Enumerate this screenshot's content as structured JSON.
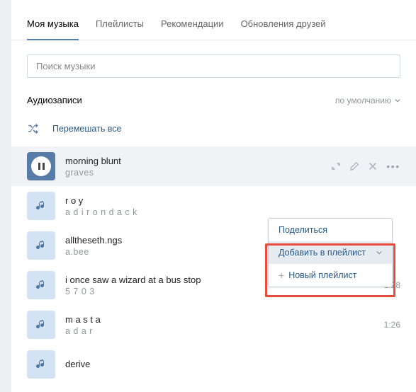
{
  "tabs": [
    "Моя музыка",
    "Плейлисты",
    "Рекомендации",
    "Обновления друзей"
  ],
  "search": {
    "placeholder": "Поиск музыки"
  },
  "section": {
    "title": "Аудиозаписи",
    "sort": "по умолчанию"
  },
  "shuffle": "Перемешать все",
  "tracks": [
    {
      "title": "morning blunt",
      "artist": "graves",
      "duration": ""
    },
    {
      "title": "r o y",
      "artist": "a d i r o n d a c k",
      "duration": ""
    },
    {
      "title": "alltheseth.ngs",
      "artist": "a.bee",
      "duration": ""
    },
    {
      "title": "i once saw a wizard at a bus stop",
      "artist": "5 7 0 3",
      "duration": "1:28"
    },
    {
      "title": "m a s t a",
      "artist": "a d a r",
      "duration": "1:26"
    },
    {
      "title": "derive",
      "artist": "",
      "duration": ""
    }
  ],
  "popup": {
    "share": "Поделиться",
    "add_playlist": "Добавить в плейлист",
    "new_playlist": "Новый плейлист"
  }
}
